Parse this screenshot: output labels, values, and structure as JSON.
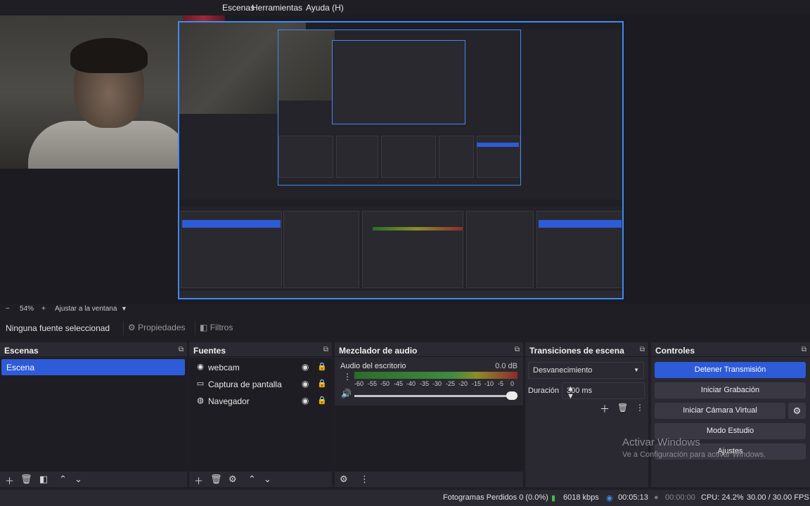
{
  "menu": {
    "items": [
      "Escenas",
      "Herramientas",
      "Ayuda (H)"
    ]
  },
  "zoom": {
    "minus": "−",
    "level": "54%",
    "plus": "+",
    "fit_label": "Ajustar a la ventana"
  },
  "source_toolbar": {
    "no_selection": "Ninguna fuente seleccionad",
    "properties": "Propiedades",
    "filters": "Filtros"
  },
  "scenes": {
    "title": "Escenas",
    "items": [
      "Escena"
    ]
  },
  "sources": {
    "title": "Fuentes",
    "items": [
      {
        "label": "webcam",
        "icon": "camera-icon"
      },
      {
        "label": "Captura de pantalla",
        "icon": "monitor-icon"
      },
      {
        "label": "Navegador",
        "icon": "globe-icon"
      }
    ]
  },
  "mixer": {
    "title": "Mezclador de audio",
    "channel": "Audio del escritorio",
    "db": "0.0 dB",
    "ticks": [
      "-60",
      "-55",
      "-50",
      "-45",
      "-40",
      "-35",
      "-30",
      "-25",
      "-20",
      "-15",
      "-10",
      "-5",
      "0"
    ],
    "volume": 1.0
  },
  "transitions": {
    "title": "Transiciones de escena",
    "selected": "Desvanecimiento",
    "duration_label": "Duración",
    "duration_value": "300 ms"
  },
  "controls": {
    "title": "Controles",
    "buttons": [
      "Detener Transmisión",
      "Iniciar Grabación",
      "Iniciar Cámara Virtual",
      "Modo Estudio",
      "Ajustes"
    ]
  },
  "watermark": {
    "title": "Activar Windows",
    "subtitle": "Ve a Configuración para activar Windows."
  },
  "status": {
    "dropped": "Fotogramas Perdidos 0 (0.0%)",
    "bitrate": "6018 kbps",
    "stream_time": "00:05:13",
    "rec_time": "00:00:00",
    "cpu": "CPU: 24.2%",
    "fps": "30.00 / 30.00 FPS"
  },
  "colors": {
    "accent": "#2e5bd8",
    "canvas_border": "#3d8bf0",
    "bg": "#1f1e24"
  }
}
